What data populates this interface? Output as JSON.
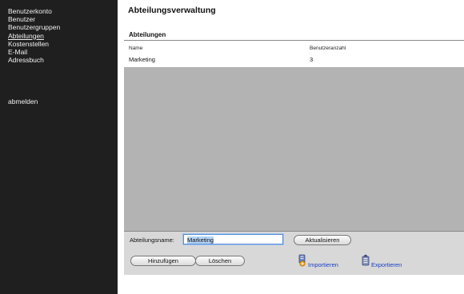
{
  "sidebar": {
    "nav": [
      "Benutzerkonto",
      "Benutzer",
      "Benutzergruppen",
      "Abteilungen",
      "Kostenstellen",
      "E-Mail",
      "Adressbuch"
    ],
    "active": "Abteilungen",
    "logout": "abmelden",
    "background": "#1f1f1f"
  },
  "main": {
    "title": "Abteilungsverwaltung",
    "section_title": "Abteilungen",
    "columns": {
      "name": "Name",
      "count": "Benutzeranzahl"
    },
    "rows": [
      {
        "name": "Marketing",
        "count": "3"
      }
    ],
    "empty_area_color": "#b3b3b3"
  },
  "form": {
    "name_label": "Abteilungsname:",
    "name_value": "Marketing",
    "update_button": "Aktualisieren",
    "add_button": "Hinzufügen",
    "delete_button": "Löschen",
    "import_link": "Importieren",
    "export_link": "Exportieren",
    "import_icon": "import-icon",
    "export_icon": "export-icon",
    "link_color": "#1a3fc6",
    "panel_color": "#d8d8d8"
  }
}
